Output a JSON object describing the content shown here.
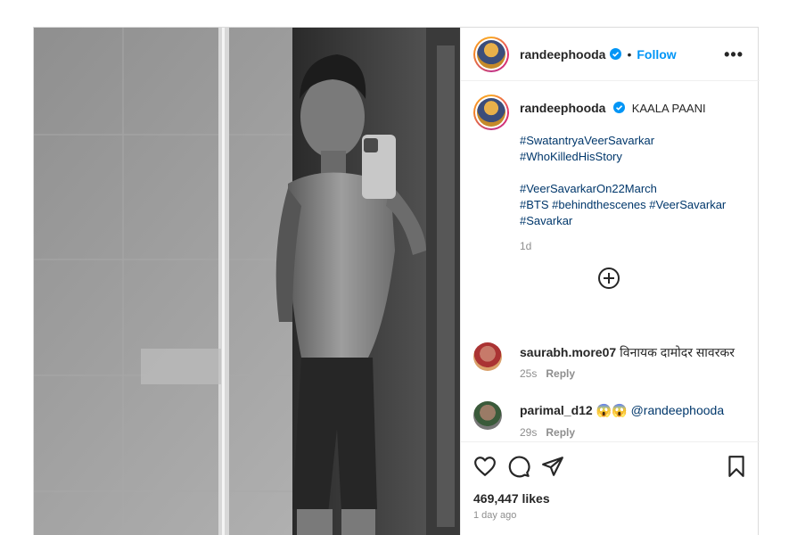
{
  "post": {
    "username": "randeephooda",
    "separator": "•",
    "follow_label": "Follow",
    "more_label": "•••",
    "caption": {
      "username": "randeephooda",
      "text": "KAALA PAANI",
      "tags_group1": [
        "#SwatantryaVeerSavarkar",
        "#WhoKilledHisStory"
      ],
      "tags_group2": [
        "#VeerSavarkarOn22March",
        "#BTS #behindthescenes #VeerSavarkar",
        "#Savarkar"
      ],
      "time": "1d"
    },
    "comments": [
      {
        "username": "saurabh.more07",
        "text": "विनायक दामोदर सावरकर",
        "time": "25s",
        "reply": "Reply"
      },
      {
        "username": "parimal_d12",
        "emoji": "😱😱",
        "mention": "@randeephooda",
        "time": "29s",
        "reply": "Reply"
      },
      {
        "username": "",
        "text": "",
        "time": "",
        "reply": ""
      }
    ],
    "likes": "469,447 likes",
    "posted": "1 day ago"
  },
  "icons": {
    "verified": "verified-badge-icon",
    "more": "more-options-icon",
    "load_more": "plus-circle-icon",
    "like": "heart-icon",
    "comment": "comment-bubble-icon",
    "share": "paper-plane-icon",
    "save": "bookmark-icon"
  },
  "colors": {
    "accent": "#0095f6",
    "hashtag": "#00376b",
    "muted": "#8e8e8e"
  }
}
